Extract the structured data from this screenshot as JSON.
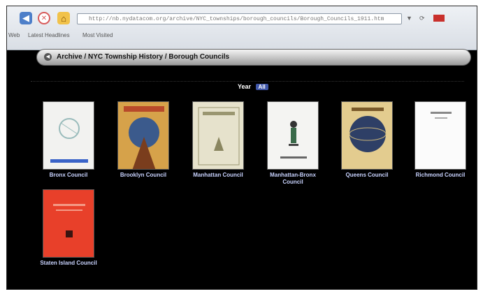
{
  "browser": {
    "url": "http://nb.nydatacom.org/archive/NYC_townships/borough_councils/Borough_Councils_1911.htm",
    "bookmarks": [
      "Web",
      "Latest Headlines",
      "Most Visited"
    ]
  },
  "breadcrumb": {
    "text": "Archive / NYC Township History / Borough Councils"
  },
  "filter": {
    "label": "Year",
    "value": "All"
  },
  "items": [
    {
      "label": "Bronx Council",
      "cover_color": "#f2f2f0"
    },
    {
      "label": "Brooklyn Council",
      "cover_color": "#d6a24a"
    },
    {
      "label": "Manhattan Council",
      "cover_color": "#e6e2cc"
    },
    {
      "label": "Manhattan-Bronx Council",
      "cover_color": "#f4f4f2"
    },
    {
      "label": "Queens Council",
      "cover_color": "#e3cc8f"
    },
    {
      "label": "Richmond Council",
      "cover_color": "#fbfbfb"
    },
    {
      "label": "Staten Island Council",
      "cover_color": "#e8402a"
    }
  ]
}
